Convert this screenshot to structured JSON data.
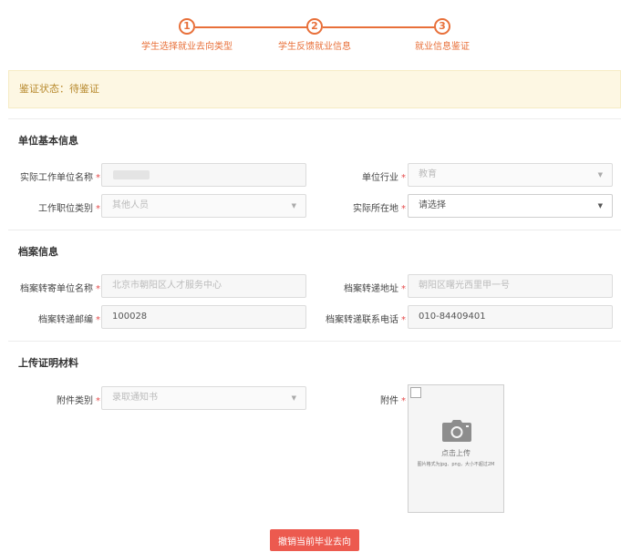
{
  "stepper": {
    "steps": [
      {
        "number": "1",
        "label": "学生选择就业去向类型"
      },
      {
        "number": "2",
        "label": "学生反馈就业信息"
      },
      {
        "number": "3",
        "label": "就业信息鉴证"
      }
    ]
  },
  "status": {
    "text": "鉴证状态：待鉴证"
  },
  "unit_section": {
    "title": "单位基本信息",
    "company_name": {
      "label": "实际工作单位名称",
      "value": ""
    },
    "industry": {
      "label": "单位行业",
      "value": "教育"
    },
    "position_category": {
      "label": "工作职位类别",
      "value": "其他人员"
    },
    "location": {
      "label": "实际所在地",
      "value": "请选择"
    }
  },
  "archive_section": {
    "title": "档案信息",
    "receiver": {
      "label": "档案转寄单位名称",
      "value": "北京市朝阳区人才服务中心"
    },
    "address": {
      "label": "档案转递地址",
      "value": "朝阳区曙光西里甲一号"
    },
    "postcode": {
      "label": "档案转递邮编",
      "value": "100028"
    },
    "phone": {
      "label": "档案转递联系电话",
      "value": "010-84409401"
    }
  },
  "upload_section": {
    "title": "上传证明材料",
    "attachment_type": {
      "label": "附件类别",
      "value": "录取通知书"
    },
    "attachment": {
      "label": "附件",
      "upload_text": "点击上传",
      "hint": "图片格式为jpg、png，大小不超过2M"
    }
  },
  "required_mark": "*",
  "actions": {
    "cancel_label": "撤销当前毕业去向"
  },
  "colors": {
    "accent": "#e8703a",
    "status_bg": "#fdf7e3",
    "status_text": "#b88a2e",
    "danger": "#ec5a4f"
  },
  "icons": {
    "camera": "camera-icon",
    "caret": "caret-down-icon"
  }
}
